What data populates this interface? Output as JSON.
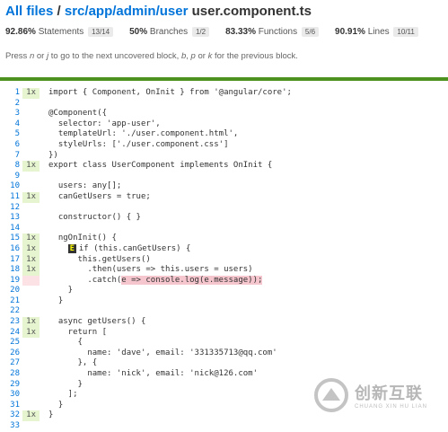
{
  "header": {
    "crumb_all": "All files",
    "crumb_sep": "/",
    "crumb_path": "src/app/admin/user",
    "file": "user.component.ts"
  },
  "stats": [
    {
      "pct": "92.86%",
      "label": "Statements",
      "frac": "13/14"
    },
    {
      "pct": "50%",
      "label": "Branches",
      "frac": "1/2"
    },
    {
      "pct": "83.33%",
      "label": "Functions",
      "frac": "5/6"
    },
    {
      "pct": "90.91%",
      "label": "Lines",
      "frac": "10/11"
    }
  ],
  "hint": {
    "p1": "Press ",
    "k1": "n",
    "p2": " or ",
    "k2": "j",
    "p3": " to go to the next uncovered block, ",
    "k3": "b",
    "p4": ", ",
    "k4": "p",
    "p5": " or ",
    "k5": "k",
    "p6": " for the previous block."
  },
  "colors": {
    "accent": "#0074d9",
    "coverage_bar": "#4d9221",
    "hit": "#e6f5d0",
    "miss": "#fce1e5"
  },
  "lines": [
    {
      "n": "1",
      "c": "1x",
      "t": "import { Component, OnInit } from '@angular/core';"
    },
    {
      "n": "2",
      "c": "",
      "t": ""
    },
    {
      "n": "3",
      "c": "",
      "t": "@Component({"
    },
    {
      "n": "4",
      "c": "",
      "t": "  selector: 'app-user',"
    },
    {
      "n": "5",
      "c": "",
      "t": "  templateUrl: './user.component.html',"
    },
    {
      "n": "6",
      "c": "",
      "t": "  styleUrls: ['./user.component.css']"
    },
    {
      "n": "7",
      "c": "",
      "t": "})"
    },
    {
      "n": "8",
      "c": "1x",
      "t": "export class UserComponent implements OnInit {"
    },
    {
      "n": "9",
      "c": "",
      "t": ""
    },
    {
      "n": "10",
      "c": "",
      "t": "  users: any[];"
    },
    {
      "n": "11",
      "c": "1x",
      "t": "  canGetUsers = true;"
    },
    {
      "n": "12",
      "c": "",
      "t": ""
    },
    {
      "n": "13",
      "c": "",
      "t": "  constructor() { }"
    },
    {
      "n": "14",
      "c": "",
      "t": ""
    },
    {
      "n": "15",
      "c": "1x",
      "t": "  ngOnInit() {"
    },
    {
      "n": "16",
      "c": "1x",
      "t": "if (this.canGetUsers) {",
      "branch": "E"
    },
    {
      "n": "17",
      "c": "1x",
      "t": "      this.getUsers()"
    },
    {
      "n": "18",
      "c": "1x",
      "t": "        .then(users => this.users = users)"
    },
    {
      "n": "19",
      "c": "",
      "t": "        .catch(",
      "miss": "e => console.log(e.message));",
      "uncovered": true
    },
    {
      "n": "20",
      "c": "",
      "t": "    }"
    },
    {
      "n": "21",
      "c": "",
      "t": "  }"
    },
    {
      "n": "22",
      "c": "",
      "t": ""
    },
    {
      "n": "23",
      "c": "1x",
      "t": "  async getUsers() {"
    },
    {
      "n": "24",
      "c": "1x",
      "t": "    return ["
    },
    {
      "n": "25",
      "c": "",
      "t": "      {"
    },
    {
      "n": "26",
      "c": "",
      "t": "        name: 'dave', email: '331335713@qq.com'"
    },
    {
      "n": "27",
      "c": "",
      "t": "      }, {"
    },
    {
      "n": "28",
      "c": "",
      "t": "        name: 'nick', email: 'nick@126.com'"
    },
    {
      "n": "29",
      "c": "",
      "t": "      }"
    },
    {
      "n": "30",
      "c": "",
      "t": "    ];"
    },
    {
      "n": "31",
      "c": "",
      "t": "  }"
    },
    {
      "n": "32",
      "c": "1x",
      "t": "}"
    },
    {
      "n": "33",
      "c": "",
      "t": ""
    }
  ],
  "watermark": {
    "cn": "创新互联",
    "en": "CHUANG XIN HU LIAN"
  }
}
